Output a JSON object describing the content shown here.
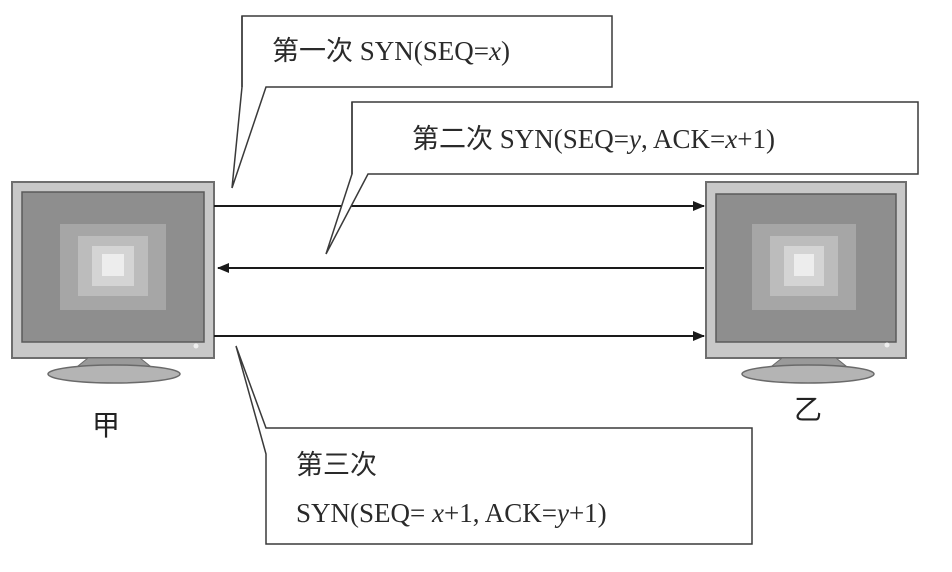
{
  "hosts": {
    "left": {
      "label": "甲"
    },
    "right": {
      "label": "乙"
    }
  },
  "messages": [
    {
      "step": "第一次",
      "text_pre": "SYN(SEQ=",
      "x_var": "x",
      "text_post": ")"
    },
    {
      "step": "第二次",
      "text_pre": "SYN(SEQ=",
      "y_var": "y",
      "mid": ", ACK=",
      "x_var": "x",
      "text_post": "+1)"
    },
    {
      "step": "第三次",
      "text_pre": "SYN(SEQ= ",
      "x_var": "x",
      "mid": "+1, ACK=",
      "y_var": "y",
      "text_post": "+1)"
    }
  ],
  "colors": {
    "monitor_frame": "#a9a9a9",
    "monitor_screen": "#8c8c8c",
    "arrow": "#1a1a1a"
  }
}
